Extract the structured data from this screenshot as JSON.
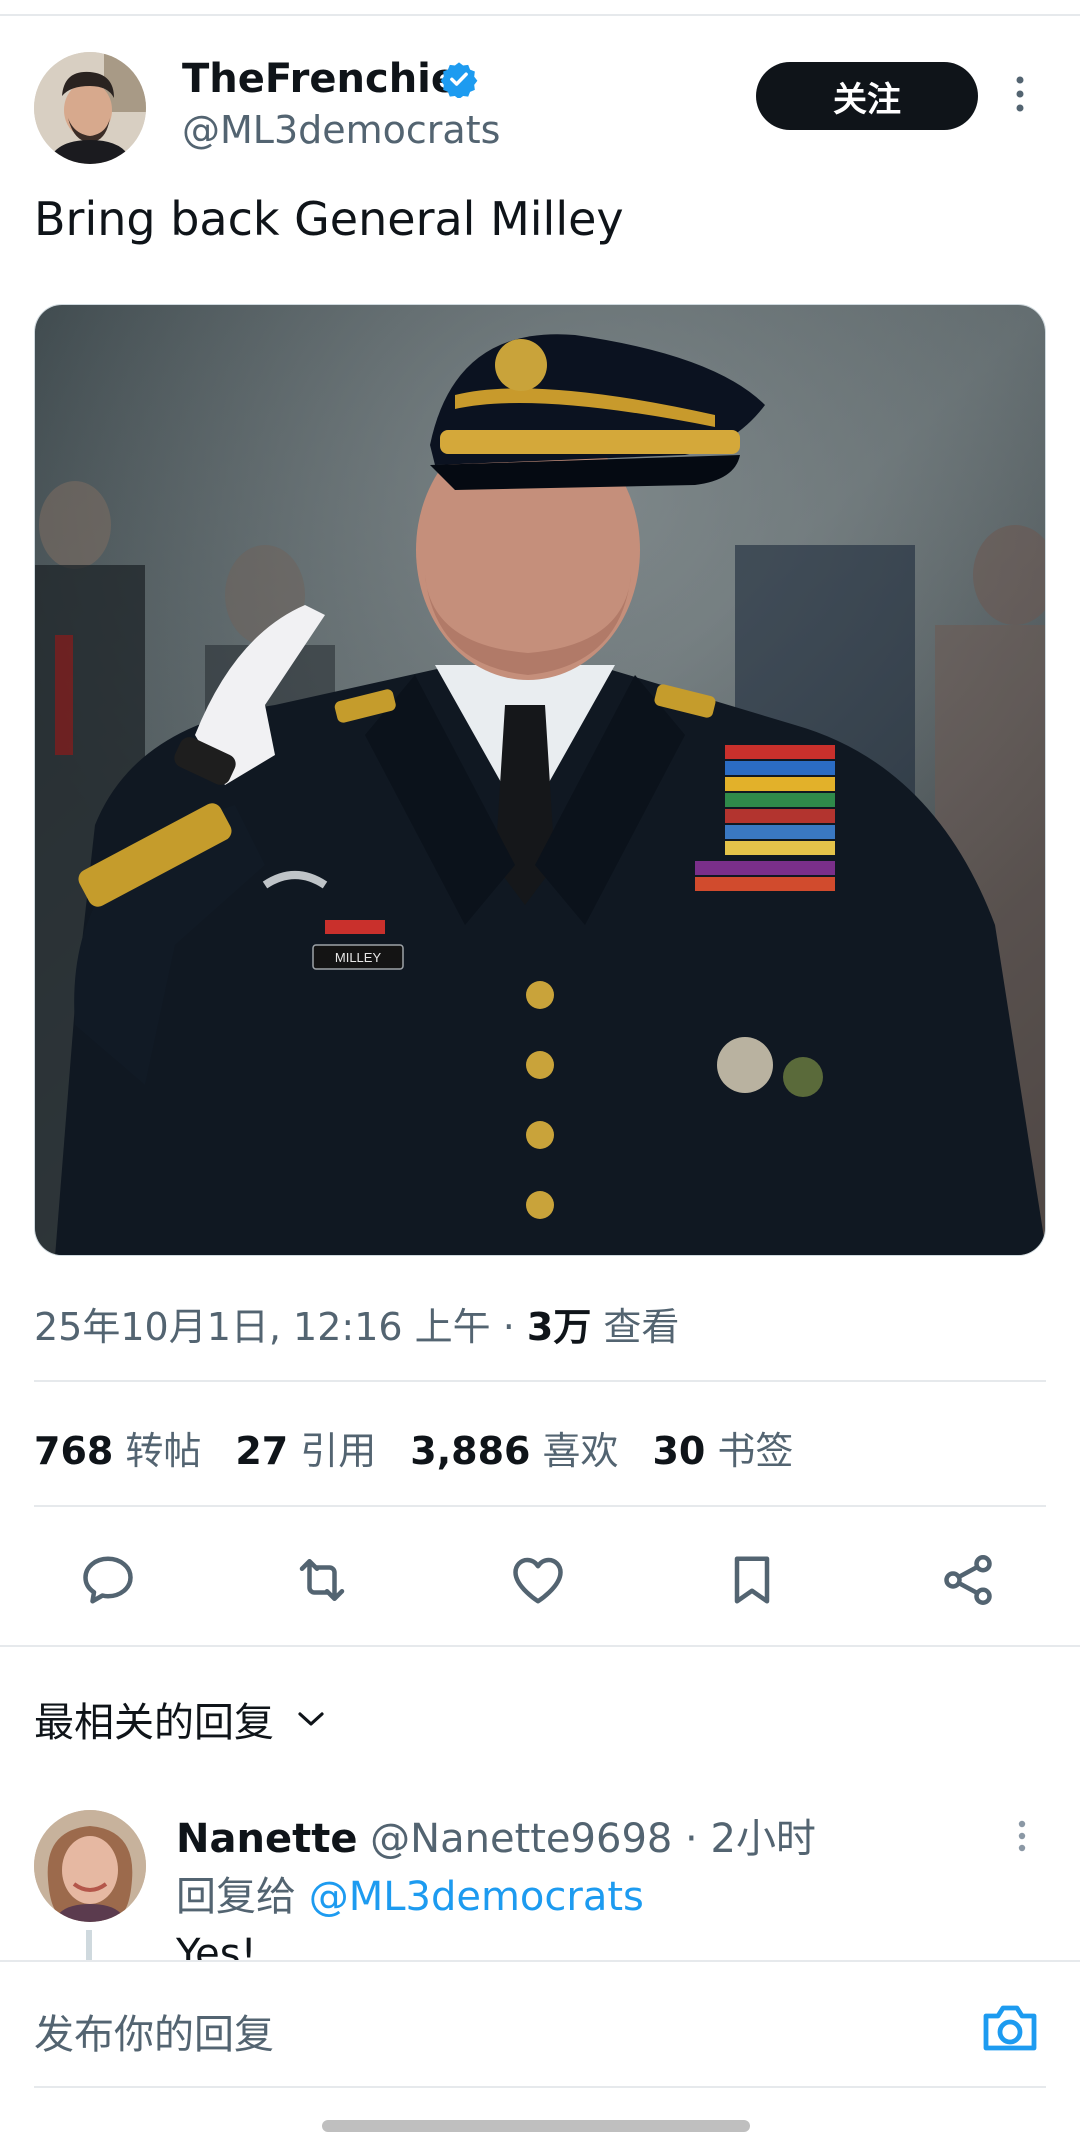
{
  "author": {
    "name": "TheFrenchie",
    "handle": "@ML3democrats",
    "follow_label": "关注"
  },
  "tweet": {
    "text": "Bring back General Milley",
    "photo_name_tag": "MILLEY",
    "timestamp": "25年10月1日, 12:16 上午",
    "separator": " · ",
    "views_count": "3万",
    "views_label": " 查看"
  },
  "stats": [
    {
      "num": "768",
      "label": "转帖"
    },
    {
      "num": "27",
      "label": "引用"
    },
    {
      "num": "3,886",
      "label": "喜欢"
    },
    {
      "num": "30",
      "label": "书签"
    }
  ],
  "actions": [
    "reply-icon",
    "retweet-icon",
    "like-icon",
    "bookmark-icon",
    "share-icon"
  ],
  "replies": {
    "sort_label": "最相关的回复",
    "items": [
      {
        "name": "Nanette",
        "handle": "@Nanette9698",
        "time": " · 2小时",
        "reply_to_prefix": "回复给 ",
        "reply_to_handle": "@ML3democrats",
        "text": "Yes!"
      }
    ]
  },
  "composer": {
    "placeholder": "发布你的回复"
  },
  "colors": {
    "accent": "#1d9bf0",
    "text": "#0f1419",
    "secondary": "#536471"
  }
}
